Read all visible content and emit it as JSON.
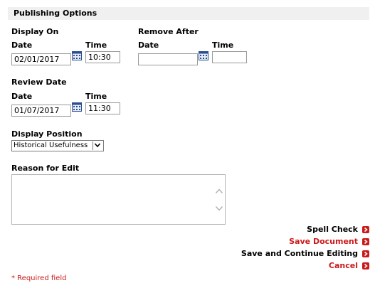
{
  "section": {
    "title": "Publishing Options"
  },
  "display_on": {
    "label": "Display On",
    "date_label": "Date",
    "time_label": "Time",
    "date_value": "02/01/2017",
    "time_value": "10:30"
  },
  "remove_after": {
    "label": "Remove After",
    "date_label": "Date",
    "time_label": "Time",
    "date_value": "",
    "time_value": ""
  },
  "review_date": {
    "label": "Review Date",
    "date_label": "Date",
    "time_label": "Time",
    "date_value": "01/07/2017",
    "time_value": "11:30"
  },
  "display_position": {
    "label": "Display Position",
    "selected": "Historical Usefulness"
  },
  "reason": {
    "label": "Reason for Edit",
    "value": ""
  },
  "actions": {
    "spell_check": "Spell Check",
    "save_document": "Save Document",
    "save_continue": "Save and Continue Editing",
    "cancel": "Cancel"
  },
  "required_note": "* Required field",
  "colors": {
    "accent_red": "#cc1a1a",
    "header_bg": "#f0f0f0",
    "calendar_blue": "#2a4f8f"
  },
  "icons": {
    "calendar": "calendar-icon",
    "dropdown": "chevron-down-icon",
    "action_arrow": "arrow-right-icon"
  }
}
